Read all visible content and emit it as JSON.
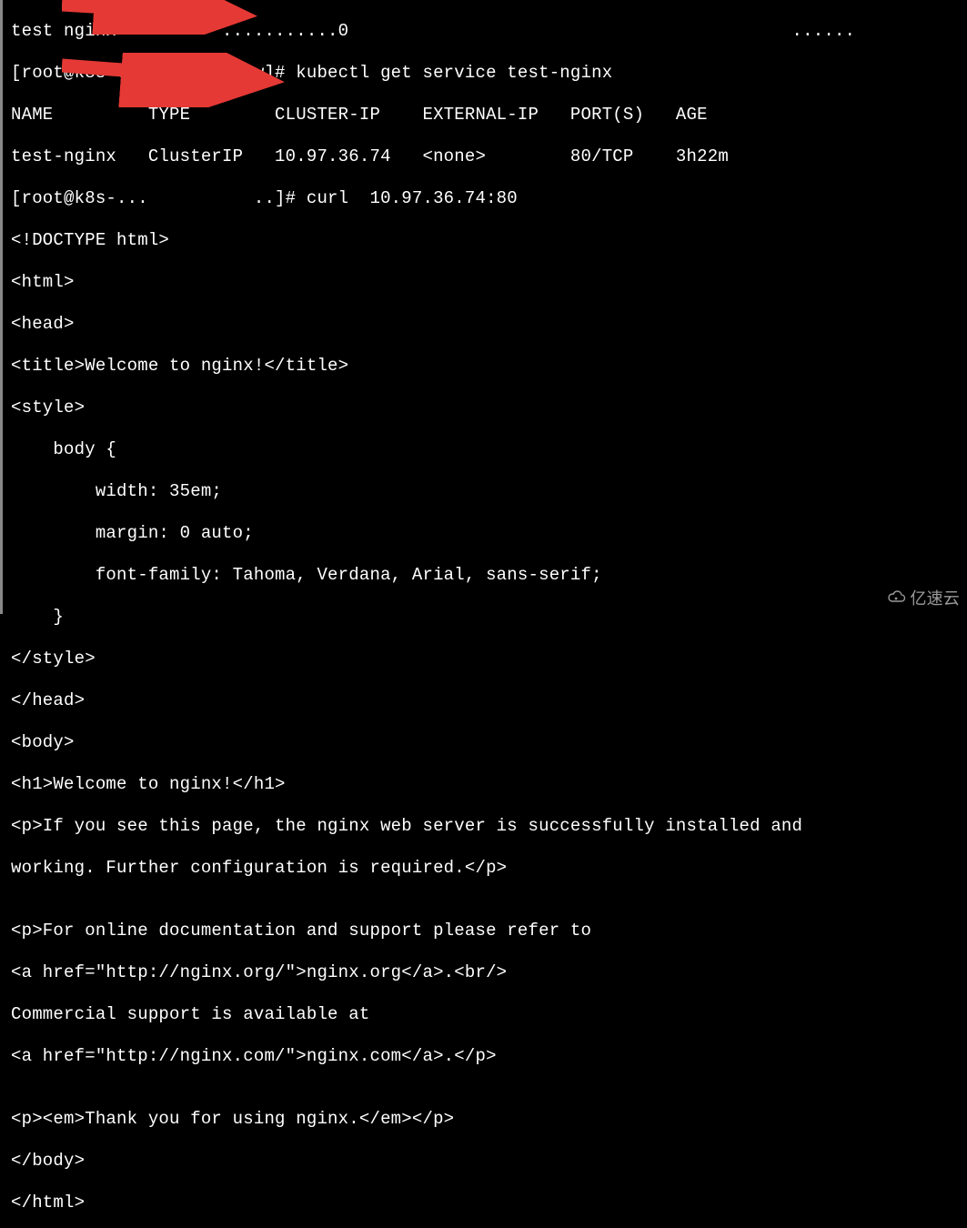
{
  "terminal": {
    "lines": [
      "test nginx          ...........0                                          ......",
      "[root@k8s-...        new]# kubectl get service test-nginx",
      "NAME         TYPE        CLUSTER-IP    EXTERNAL-IP   PORT(S)   AGE",
      "test-nginx   ClusterIP   10.97.36.74   <none>        80/TCP    3h22m",
      "[root@k8s-...          ..]# curl  10.97.36.74:80",
      "<!DOCTYPE html>",
      "<html>",
      "<head>",
      "<title>Welcome to nginx!</title>",
      "<style>",
      "    body {",
      "        width: 35em;",
      "        margin: 0 auto;",
      "        font-family: Tahoma, Verdana, Arial, sans-serif;",
      "    }",
      "</style>",
      "</head>",
      "<body>",
      "<h1>Welcome to nginx!</h1>",
      "<p>If you see this page, the nginx web server is successfully installed and",
      "working. Further configuration is required.</p>",
      "",
      "<p>For online documentation and support please refer to",
      "<a href=\"http://nginx.org/\">nginx.org</a>.<br/>",
      "Commercial support is available at",
      "<a href=\"http://nginx.com/\">nginx.com</a>.</p>",
      "",
      "<p><em>Thank you for using nginx.</em></p>",
      "</body>",
      "</html>"
    ]
  },
  "commands": {
    "prompt1": "[root@k8s-...        new]# ",
    "cmd1": "kubectl get service test-nginx",
    "header_name": "NAME",
    "header_type": "TYPE",
    "header_clusterip": "CLUSTER-IP",
    "header_externalip": "EXTERNAL-IP",
    "header_ports": "PORT(S)",
    "header_age": "AGE",
    "svc_name": "test-nginx",
    "svc_type": "ClusterIP",
    "svc_clusterip": "10.97.36.74",
    "svc_externalip": "<none>",
    "svc_ports": "80/TCP",
    "svc_age": "3h22m",
    "prompt2": "[root@k8s-...          ..]# ",
    "cmd2": "curl  10.97.36.74:80"
  },
  "arrows": {
    "color": "#e53935"
  },
  "watermark": {
    "text": "亿速云"
  }
}
